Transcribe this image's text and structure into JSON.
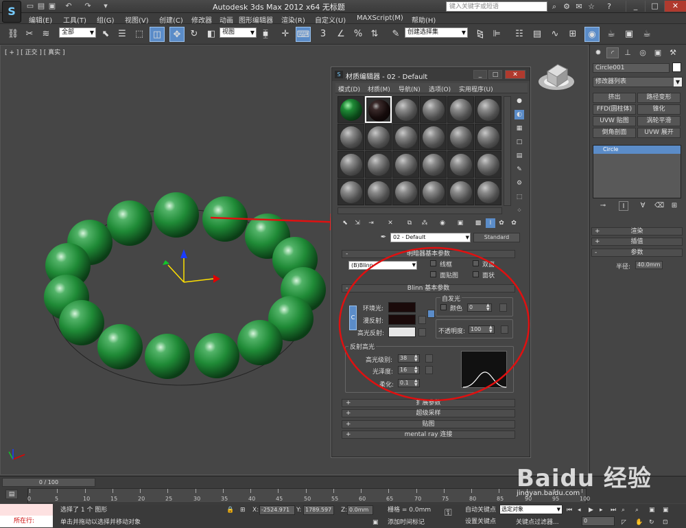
{
  "titlebar": {
    "title": "Autodesk 3ds Max  2012 x64     无标题",
    "search_placeholder": "键入关键字或短语",
    "logo_glyph": "S"
  },
  "menubar": {
    "items": [
      "编辑(E)",
      "工具(T)",
      "组(G)",
      "视图(V)",
      "创建(C)",
      "修改器",
      "动画",
      "图形编辑器",
      "渲染(R)",
      "自定义(U)",
      "MAXScript(M)",
      "帮助(H)"
    ]
  },
  "toolbar": {
    "selection_filter": "全部",
    "ref_coord": "视图",
    "named_selection": "创建选择集"
  },
  "viewport": {
    "label": "[ + ] [ 正交 ] [ 真实 ]"
  },
  "material_editor": {
    "title": "材质编辑器 - 02 - Default",
    "menu": [
      "模式(D)",
      "材质(M)",
      "导航(N)",
      "选项(O)",
      "实用程序(U)"
    ],
    "material_name": "02 - Default",
    "material_type": "Standard",
    "shader_rollout": {
      "title": "明暗器基本参数",
      "shader": "(B)Blinn",
      "options": [
        "线框",
        "双面",
        "面贴图",
        "面状"
      ]
    },
    "blinn_rollout": {
      "title": "Blinn 基本参数",
      "self_illum_title": "自发光",
      "self_illum_color_label": "颜色",
      "self_illum_value": "0",
      "ambient_label": "环境光:",
      "diffuse_label": "漫反射:",
      "specular_label": "高光反射:",
      "opacity_label": "不透明度:",
      "opacity_value": "100",
      "lock_glyph": "C",
      "specular_highlights_title": "反射高光",
      "specular_level_label": "高光级别:",
      "specular_level_value": "38",
      "glossiness_label": "光泽度:",
      "glossiness_value": "16",
      "soften_label": "柔化:",
      "soften_value": "0.1"
    },
    "collapsed_rollouts": [
      "扩展参数",
      "超级采样",
      "贴图",
      "mental ray 连接"
    ]
  },
  "command_panel": {
    "object_name": "Circle001",
    "modifier_list": "修改器列表",
    "modifier_buttons": [
      "挤出",
      "路径变形",
      "FFD(圆柱体)",
      "锥化",
      "UVW 贴图",
      "涡轮平滑",
      "倒角剖面",
      "UVW 展开"
    ],
    "stack_item": "Circle",
    "rollouts": [
      "渲染",
      "插值",
      "参数"
    ],
    "radius_label": "半径:",
    "radius_value": "40.0mm"
  },
  "timeline": {
    "frame_display": "0 / 100",
    "ticks": [
      "0",
      "5",
      "10",
      "15",
      "20",
      "25",
      "30",
      "35",
      "40",
      "45",
      "50",
      "55",
      "60",
      "65",
      "70",
      "75",
      "80",
      "85",
      "90",
      "95",
      "100"
    ]
  },
  "statusbar": {
    "listener_text": "所在行:",
    "selection_msg": "选择了 1 个 图形",
    "prompt": "单击并拖动以选择并移动对象",
    "x_label": "X:",
    "x_value": "-2524.971",
    "y_label": "Y:",
    "y_value": "1789.597",
    "z_label": "Z:",
    "z_value": "0.0mm",
    "grid": "栅格 = 0.0mm",
    "add_time_tag": "添加时间标记",
    "auto_key": "自动关键点",
    "set_key": "设置关键点",
    "key_mode": "选定对象",
    "key_filters": "关键点过滤器...",
    "frame_field": "0"
  },
  "watermark": {
    "brand": "Baidu 经验",
    "url": "jingyan.baidu.com"
  },
  "colors": {
    "jade": "#1f8a36",
    "annotation_red": "#e01010",
    "selection_blue": "#5b8cc8",
    "ambient_color": "#1a0a0a",
    "diffuse_color": "#1a0a0a",
    "specular_color": "#e6e6e6"
  }
}
